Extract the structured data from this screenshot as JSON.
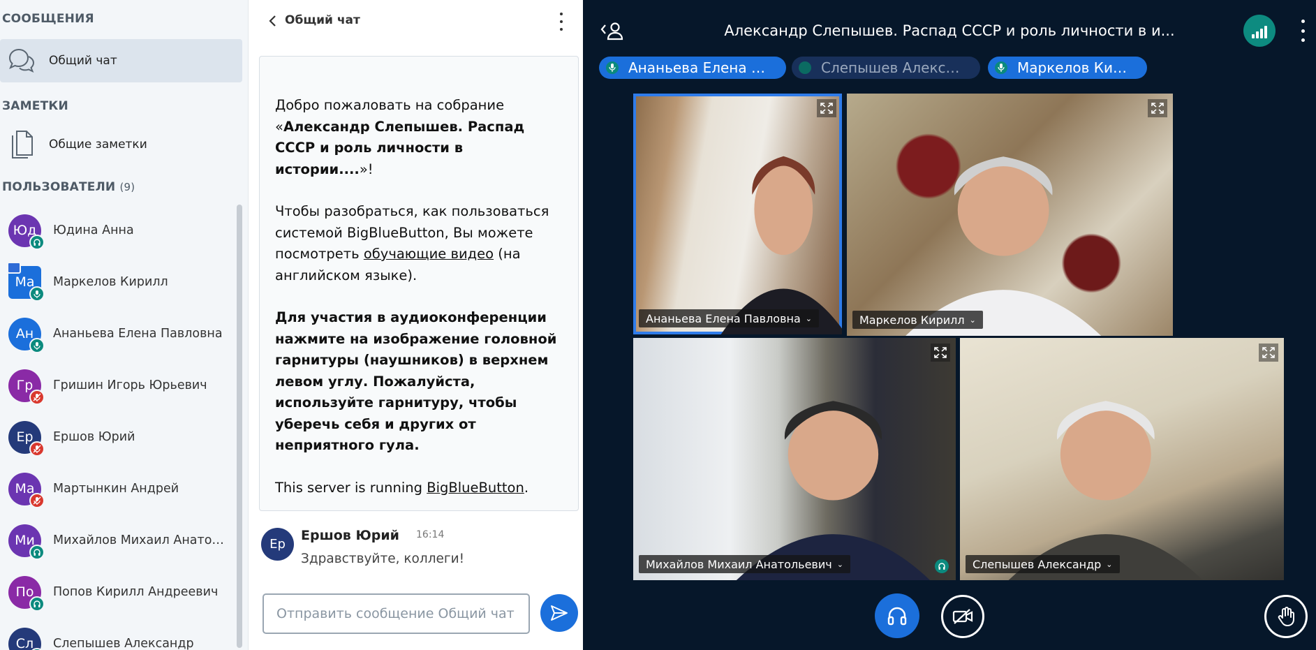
{
  "colors": {
    "accent": "#1b6fdb",
    "listen_only": "#0b8a7e",
    "muted": "#d9382e",
    "main_bg": "#06172a",
    "panel_bg": "#f3f6f9"
  },
  "userlist": {
    "messages_title": "СООБЩЕНИЯ",
    "public_chat_label": "Общий чат",
    "notes_title": "ЗАМЕТКИ",
    "shared_notes_label": "Общие заметки",
    "users_title": "ПОЛЬЗОВАТЕЛИ",
    "users_count": "(9)",
    "users": [
      {
        "initials": "Юд",
        "name": "Юдина Анна",
        "color": "#6b35b1",
        "status": "listen-only"
      },
      {
        "initials": "Ма",
        "name": "Маркелов Кирилл",
        "color": "#1b6fdb",
        "status": "mic-on",
        "presenter": true
      },
      {
        "initials": "Ан",
        "name": "Ананьева Елена Павловна",
        "color": "#1b6fdb",
        "status": "mic-on"
      },
      {
        "initials": "Гр",
        "name": "Гришин Игорь Юрьевич",
        "color": "#8a2aa6",
        "status": "muted"
      },
      {
        "initials": "Ер",
        "name": "Ершов Юрий",
        "color": "#243a7a",
        "status": "muted"
      },
      {
        "initials": "Ма",
        "name": "Мартынкин Андрей",
        "color": "#6b35b1",
        "status": "muted"
      },
      {
        "initials": "Ми",
        "name": "Михайлов Михаил Анатольевич",
        "color": "#6b35b1",
        "status": "listen-only"
      },
      {
        "initials": "По",
        "name": "Попов Кирилл Андреевич",
        "color": "#8a2aa6",
        "status": "listen-only"
      },
      {
        "initials": "Сл",
        "name": "Слепышев Александр",
        "color": "#243a7a",
        "status": "listen-only"
      }
    ]
  },
  "chat": {
    "title": "Общий чат",
    "welcome": {
      "p1_a": "Добро пожаловать на собрание «",
      "p1_b": "Александр Слепышев. Распад СССР и роль личности в истории....",
      "p1_c": "»!",
      "p2_a": "Чтобы разобраться, как пользоваться системой BigBlueButton, Вы можете посмотреть ",
      "p2_link": "обучающие видео",
      "p2_b": " (на английском языке).",
      "p3_a": "Для участия в аудиоконференции нажмите на изображение головной гарнитуры (наушников) в верхнем левом углу. ",
      "p3_b": "Пожалуйста, используйте гарнитуру, чтобы уберечь себя и других от неприятного гула",
      "p3_c": ".",
      "p4_a": "This server is running ",
      "p4_link": "BigBlueButton",
      "p4_b": "."
    },
    "message": {
      "initials": "Ер",
      "author": "Ершов Юрий",
      "time": "16:14",
      "text": "Здравствуйте, коллеги!"
    },
    "input_placeholder": "Отправить сообщение Общий чат"
  },
  "main": {
    "meeting_title": "Александр Слепышев. Распад СССР и роль личности в и...",
    "talkers": [
      {
        "name": "Ананьева Елена П...",
        "active": true
      },
      {
        "name": "Слепышев Александр",
        "active": false
      },
      {
        "name": "Маркелов Кирилл",
        "active": true
      }
    ],
    "videos": [
      {
        "name": "Ананьева Елена Павловна",
        "speaking": true
      },
      {
        "name": "Маркелов Кирилл",
        "speaking": false
      },
      {
        "name": "Михайлов Михаил Анатольевич",
        "speaking": false
      },
      {
        "name": "Слепышев Александр",
        "speaking": false
      }
    ]
  }
}
